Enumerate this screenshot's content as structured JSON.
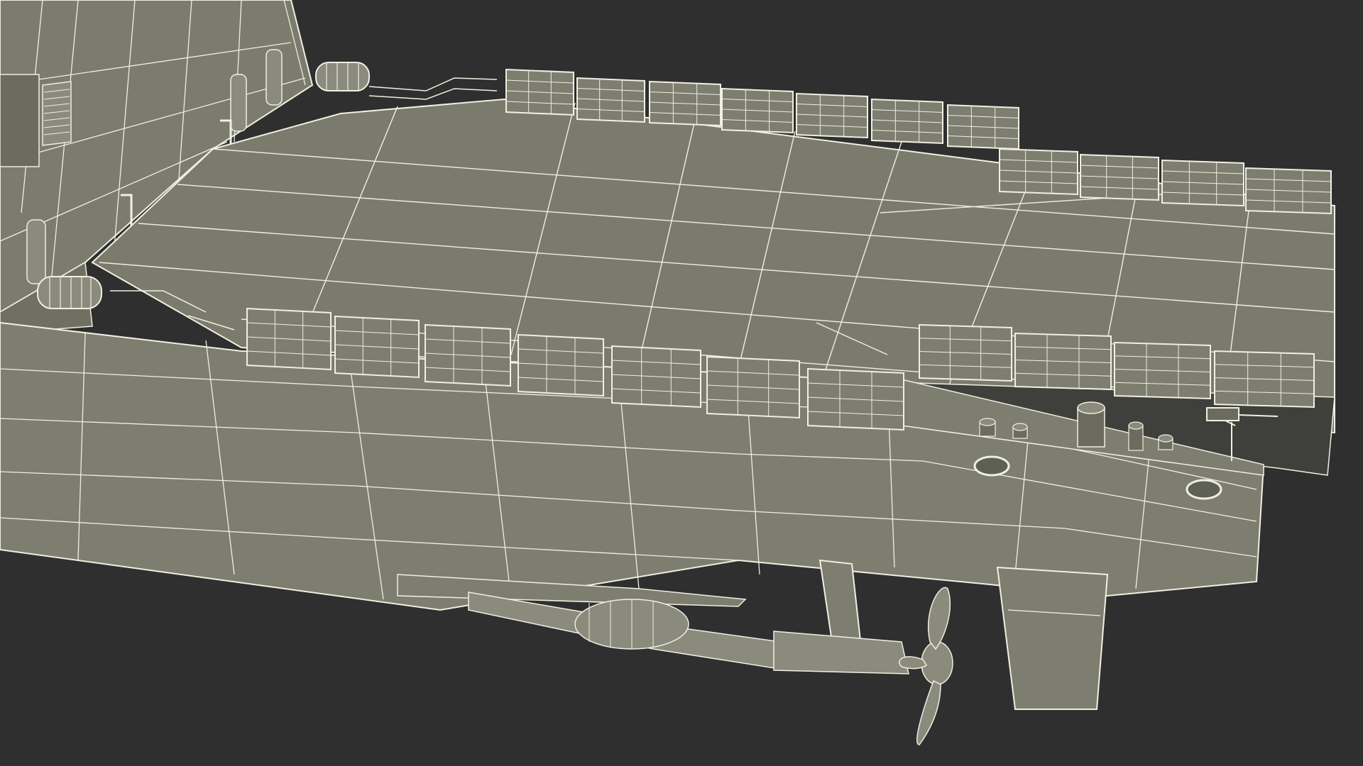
{
  "scene": {
    "subject": "ship-stern-wireframe",
    "colors": {
      "background": "#2f2f2f",
      "surface": "#7d7e6f",
      "surface_dark": "#6e6f61",
      "surface_shadow": "#3f403b",
      "wire": "#efefe2"
    }
  }
}
